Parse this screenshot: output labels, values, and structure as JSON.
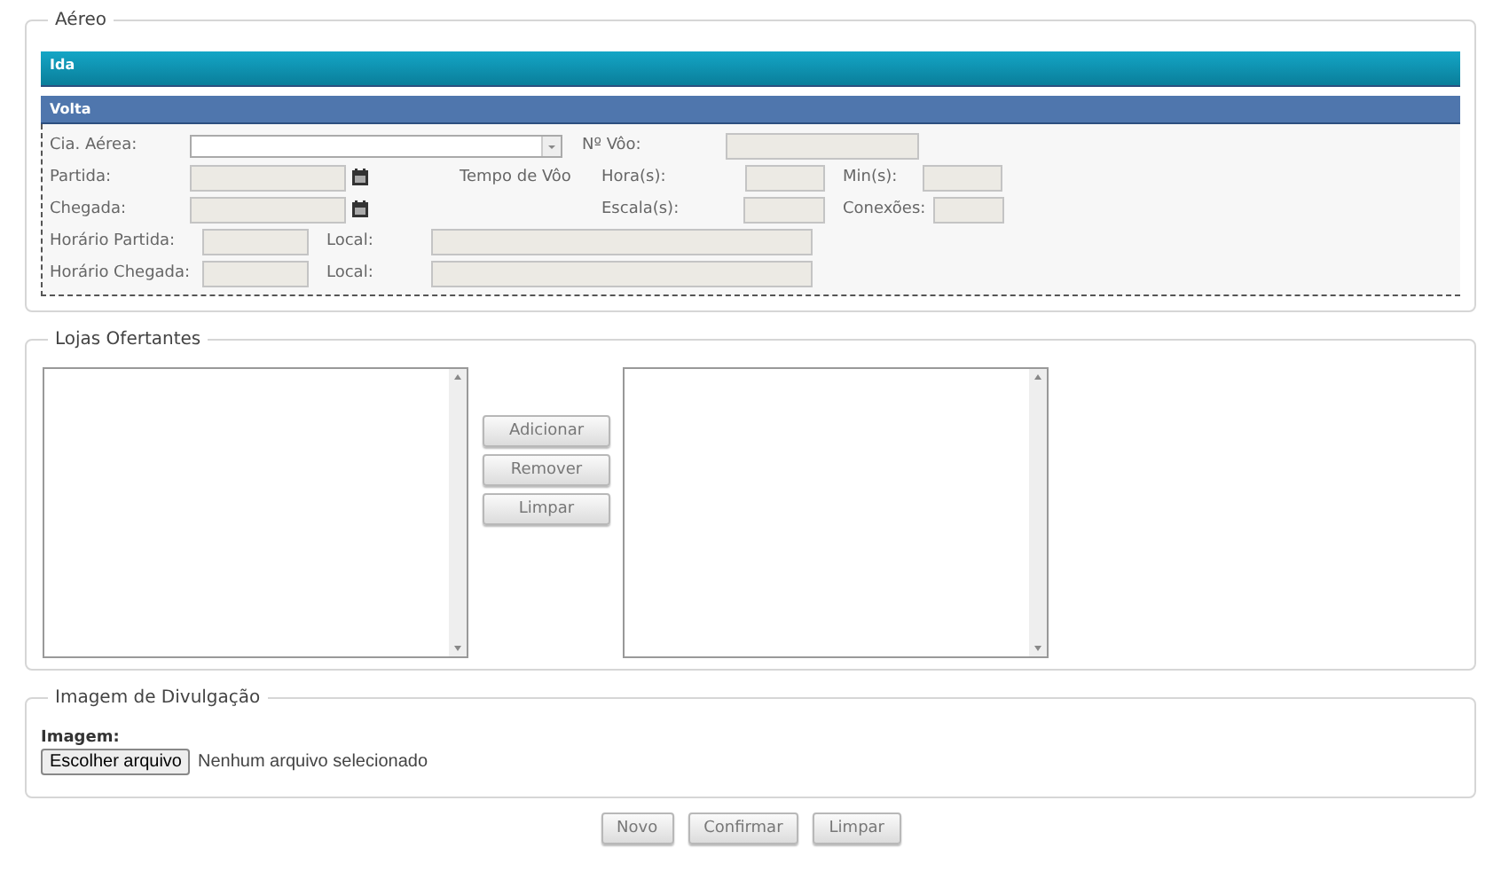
{
  "aereo": {
    "legend": "Aéreo",
    "panels": [
      {
        "title": "Ida",
        "expanded": false
      },
      {
        "title": "Volta",
        "expanded": true
      }
    ],
    "form": {
      "cia_label": "Cia. Aérea:",
      "voo_label": "Nº Vôo:",
      "partida_label": "Partida:",
      "tempo_label": "Tempo de Vôo",
      "hora_label": "Hora(s):",
      "min_label": "Min(s):",
      "chegada_label": "Chegada:",
      "escala_label": "Escala(s):",
      "conexoes_label": "Conexões:",
      "horario_partida_label": "Horário Partida:",
      "local_partida_label": "Local:",
      "horario_chegada_label": "Horário Chegada:",
      "local_chegada_label": "Local:"
    }
  },
  "lojas": {
    "legend": "Lojas Ofertantes",
    "buttons": [
      "Adicionar",
      "Remover",
      "Limpar"
    ]
  },
  "imagem": {
    "legend": "Imagem de Divulgação",
    "label": "Imagem:",
    "file_button": "Escolher arquivo",
    "file_status": "Nenhum arquivo selecionado"
  },
  "actions": [
    "Novo",
    "Confirmar",
    "Limpar"
  ]
}
